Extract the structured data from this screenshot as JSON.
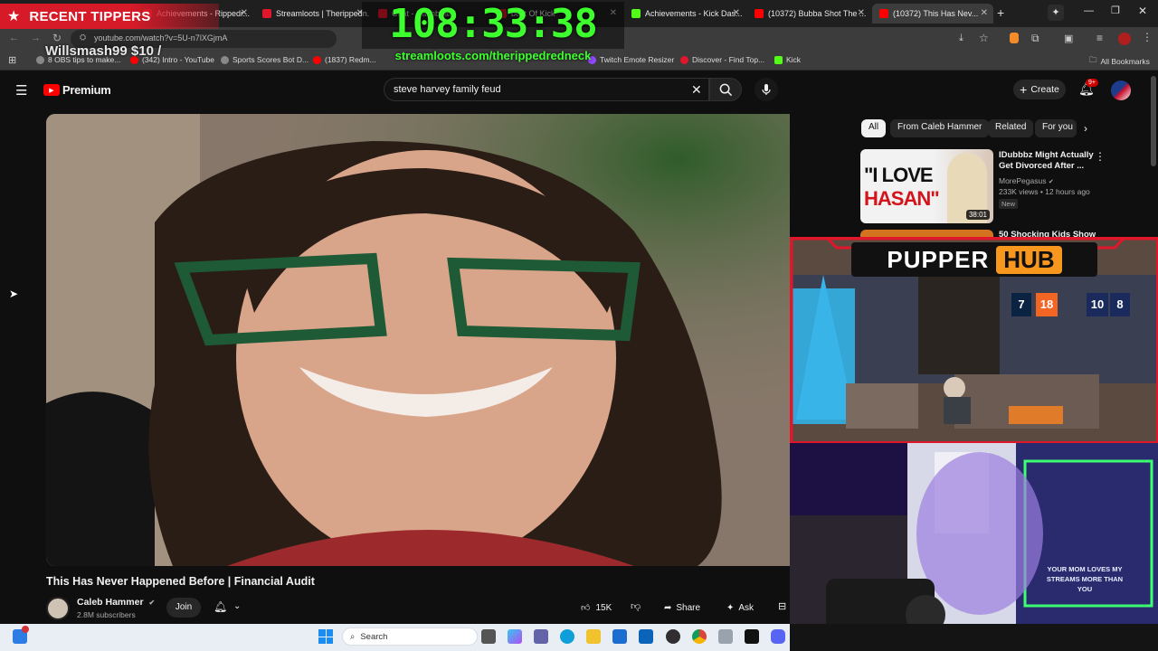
{
  "browser": {
    "tabs": [
      {
        "title": "Achievements - Rippedr...",
        "color": "#e0162b"
      },
      {
        "title": "Streamloots | Therippedn...",
        "color": "#e0162b"
      },
      {
        "title": "Chat - Dashboard",
        "color": "#e0162b"
      },
      {
        "title": "best Of Kick",
        "color": "#e0162b"
      },
      {
        "title": "Achievements - Kick Das...",
        "color": "#53fc18"
      },
      {
        "title": "(10372) Bubba Shot The ...",
        "color": "#ff0000"
      },
      {
        "title": "(10372) This Has Nev...",
        "color": "#ff0000"
      }
    ],
    "url": "youtube.com/watch?v=5U-n7lXGjmA",
    "bookmarks": [
      {
        "label": "8 OBS tips to make...",
        "color": "#888888"
      },
      {
        "label": "(342) Intro - YouTube",
        "color": "#ff0000"
      },
      {
        "label": "Sports Scores Bot D...",
        "color": "#888888"
      },
      {
        "label": "(1837) Redm...",
        "color": "#ff0000"
      },
      {
        "label": "Twitch Emote Resizer",
        "color": "#9146ff"
      },
      {
        "label": "Discover - Find Top...",
        "color": "#e0162b"
      },
      {
        "label": "Kick",
        "color": "#53fc18"
      }
    ],
    "all_bookmarks_label": "All Bookmarks"
  },
  "youtube": {
    "logo_text": "Premium",
    "search_value": "steve harvey family feud",
    "create_label": "Create",
    "notification_count": "9+",
    "video_title": "This Has Never Happened Before | Financial Audit",
    "channel_name": "Caleb Hammer",
    "subscribers": "2.8M subscribers",
    "join_label": "Join",
    "likes": "15K",
    "share_label": "Share",
    "ask_label": "Ask",
    "chips": [
      "All",
      "From Caleb Hammer",
      "Related",
      "For you"
    ],
    "recommendations": [
      {
        "title_line1": "IDubbbz Might Actually",
        "title_line2": "Get Divorced After ...",
        "channel": "MorePegasus",
        "meta": "233K views • 12 hours ago",
        "badge": "New",
        "duration": "38:01",
        "thumb_text_line1": "\"I LOVE",
        "thumb_text_line2": "HASAN\""
      },
      {
        "title_line1": "50 Shocking Kids Show"
      }
    ]
  },
  "stream_overlay": {
    "tipper_header": "RECENT TIPPERS",
    "tipper_entry": "Willsmash99 $10 /",
    "timer": "108:33:38",
    "streamloots_url": "streamloots.com/therippedredneck",
    "pupper_word1": "PUPPER",
    "pupper_word2": "HUB",
    "jerseys": [
      "7",
      "18",
      "10",
      "8"
    ],
    "sign_text": "YOUR MOM LOVES MY STREAMS MORE THAN YOU"
  },
  "taskbar": {
    "search_label": "Search"
  },
  "colors": {
    "accent_red": "#e0162b",
    "timer_green": "#3dff2d",
    "yt_bg": "#0f0f0f"
  }
}
